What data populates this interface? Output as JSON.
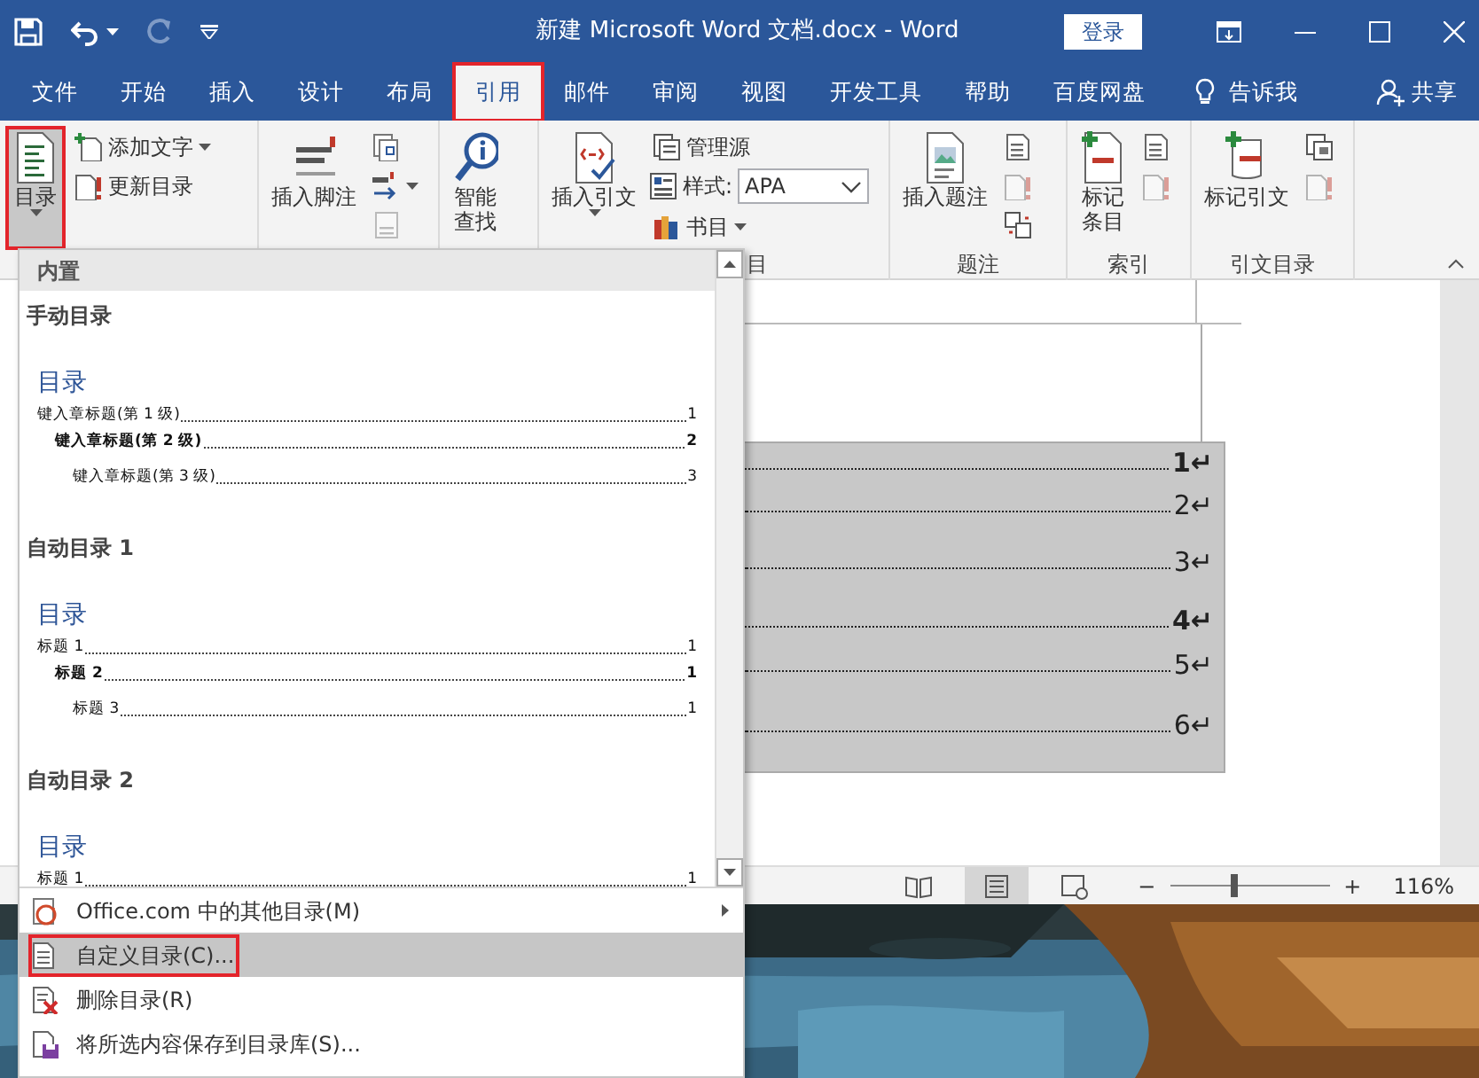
{
  "title_bar": {
    "title": "新建 Microsoft Word 文档.docx  -  Word",
    "sign_in": "登录",
    "redo_disabled": true
  },
  "tabs": [
    {
      "label": "文件",
      "selected": false,
      "annotated": false
    },
    {
      "label": "开始",
      "selected": false,
      "annotated": false
    },
    {
      "label": "插入",
      "selected": false,
      "annotated": false
    },
    {
      "label": "设计",
      "selected": false,
      "annotated": false
    },
    {
      "label": "布局",
      "selected": false,
      "annotated": false
    },
    {
      "label": "引用",
      "selected": true,
      "annotated": true
    },
    {
      "label": "邮件",
      "selected": false,
      "annotated": false
    },
    {
      "label": "审阅",
      "selected": false,
      "annotated": false
    },
    {
      "label": "视图",
      "selected": false,
      "annotated": false
    },
    {
      "label": "开发工具",
      "selected": false,
      "annotated": false
    },
    {
      "label": "帮助",
      "selected": false,
      "annotated": false
    },
    {
      "label": "百度网盘",
      "selected": false,
      "annotated": false
    }
  ],
  "tell_me": "告诉我",
  "share": "共享",
  "ribbon": {
    "groups": [
      {
        "items": [
          {
            "kind": "large",
            "label": "目录",
            "dropdown": true,
            "annotated": true
          },
          {
            "kind": "stack",
            "children": [
              {
                "kind": "small",
                "label": "添加文字",
                "dropdown": true
              },
              {
                "kind": "small",
                "label": "更新目录",
                "dropdown": false
              }
            ]
          }
        ]
      },
      {
        "items": [
          {
            "kind": "large",
            "label": "插入脚注",
            "dropdown": false,
            "annotated": false
          },
          {
            "kind": "stack",
            "children": [
              {
                "kind": "icon",
                "disabled": false,
                "dropdown": false
              },
              {
                "kind": "icon",
                "disabled": false,
                "dropdown": true
              },
              {
                "kind": "icon",
                "disabled": true,
                "dropdown": false
              }
            ]
          }
        ]
      },
      {
        "items": [
          {
            "kind": "tall",
            "label": "智能查找",
            "dropdown": false,
            "annotated": false
          }
        ]
      },
      {
        "label": "目",
        "items": [
          {
            "kind": "large",
            "label": "插入引文",
            "dropdown": true,
            "annotated": false
          },
          {
            "kind": "stack",
            "children": [
              {
                "kind": "small",
                "label": "管理源",
                "dropdown": false
              },
              {
                "kind": "select",
                "label": "样式:",
                "value": "APA"
              },
              {
                "kind": "small",
                "label": "书目",
                "dropdown": true
              }
            ]
          }
        ]
      },
      {
        "label": "题注",
        "items": [
          {
            "kind": "large",
            "label": "插入题注",
            "dropdown": false,
            "annotated": false
          },
          {
            "kind": "stack",
            "children": [
              {
                "kind": "icon",
                "disabled": false,
                "dropdown": false
              },
              {
                "kind": "icon",
                "disabled": true,
                "dropdown": false
              },
              {
                "kind": "icon",
                "disabled": false,
                "dropdown": false
              }
            ]
          }
        ]
      },
      {
        "label": "索引",
        "items": [
          {
            "kind": "tall",
            "label": "标记条目",
            "dropdown": false,
            "annotated": false
          },
          {
            "kind": "stack",
            "children": [
              {
                "kind": "icon",
                "disabled": false,
                "dropdown": false
              },
              {
                "kind": "icon",
                "disabled": true,
                "dropdown": false
              }
            ]
          }
        ]
      },
      {
        "label": "引文目录",
        "items": [
          {
            "kind": "large",
            "label": "标记引文",
            "dropdown": false,
            "annotated": false
          },
          {
            "kind": "stack",
            "children": [
              {
                "kind": "icon",
                "disabled": false,
                "dropdown": false
              },
              {
                "kind": "icon",
                "disabled": true,
                "dropdown": false
              }
            ]
          }
        ]
      }
    ]
  },
  "document": {
    "toc_numbers": [
      {
        "text": "1↵",
        "bold": true
      },
      {
        "text": "2↵",
        "bold": false
      },
      {
        "text": "3↵",
        "bold": false
      },
      {
        "text": "4↵",
        "bold": true
      },
      {
        "text": "5↵",
        "bold": false
      },
      {
        "text": "6↵",
        "bold": false
      }
    ]
  },
  "status_bar": {
    "views": [
      {
        "selected": false
      },
      {
        "selected": true
      },
      {
        "selected": false
      }
    ],
    "zoom_out": "−",
    "zoom_in": "+",
    "zoom": {
      "level": 0.4
    },
    "zoom_text": "116%"
  },
  "toc_dropdown": {
    "header": "内置",
    "sections": [
      {
        "title": "手动目录",
        "heading": "目录",
        "entries": [
          {
            "text": "键入章标题(第 1 级)",
            "page": "1",
            "children": [
              {
                "text": "键入章标题(第 2 级)",
                "page": "2",
                "children": [
                  {
                    "text": "键入章标题(第 3 级)",
                    "page": "3"
                  }
                ]
              }
            ]
          }
        ]
      },
      {
        "title": "自动目录 1",
        "heading": "目录",
        "entries": [
          {
            "text": "标题 1",
            "page": "1",
            "children": [
              {
                "text": "标题 2",
                "page": "1",
                "children": [
                  {
                    "text": "标题 3",
                    "page": "1"
                  }
                ]
              }
            ]
          }
        ]
      },
      {
        "title": "自动目录 2",
        "heading": "目录",
        "entries": [
          {
            "text": "标题 1",
            "page": "1"
          }
        ]
      }
    ],
    "menu": [
      {
        "label": "Office.com 中的其他目录(M)",
        "submenu": true,
        "highlighted": false,
        "annotated": false
      },
      {
        "label": "自定义目录(C)...",
        "submenu": false,
        "highlighted": true,
        "annotated": true
      },
      {
        "label": "删除目录(R)",
        "submenu": false,
        "highlighted": false,
        "annotated": false
      },
      {
        "label": "将所选内容保存到目录库(S)...",
        "submenu": false,
        "highlighted": false,
        "annotated": false
      }
    ]
  }
}
